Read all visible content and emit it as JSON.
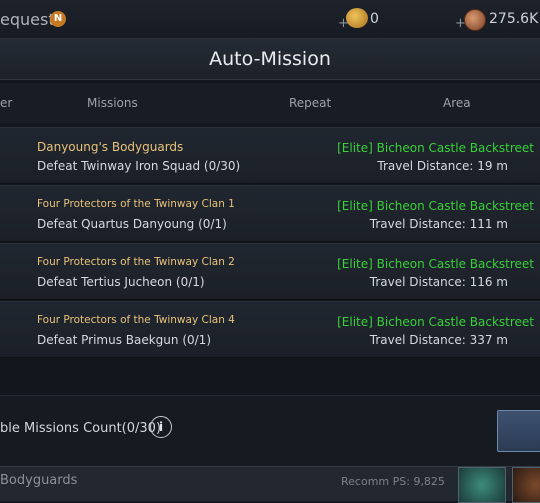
{
  "topbar": {
    "request_label": "equest",
    "badge": "N",
    "plus1": "+",
    "gold_value": "0",
    "plus2": "+",
    "copper_value": "275.6K"
  },
  "panel": {
    "title": "Auto-Mission",
    "headers": {
      "left_partial": "er",
      "missions": "Missions",
      "repeat": "Repeat",
      "area": "Area"
    }
  },
  "missions": [
    {
      "title": "Danyoung's Bodyguards",
      "objective": "Defeat Twinway Iron Squad (0/30)",
      "area": "[Elite] Bicheon Castle Backstreet",
      "distance": "Travel Distance: 19 m"
    },
    {
      "title": "Four Protectors of the Twinway Clan 1",
      "objective": "Defeat Quartus Danyoung (0/1)",
      "area": "[Elite] Bicheon Castle Backstreet",
      "distance": "Travel Distance: 111 m"
    },
    {
      "title": "Four Protectors of the Twinway Clan 2",
      "objective": "Defeat Tertius Jucheon (0/1)",
      "area": "[Elite] Bicheon Castle Backstreet",
      "distance": "Travel Distance: 116 m"
    },
    {
      "title": "Four Protectors of the Twinway Clan 4",
      "objective": "Defeat Primus Baekgun (0/1)",
      "area": "[Elite] Bicheon Castle Backstreet",
      "distance": "Travel Distance: 337 m"
    }
  ],
  "footer": {
    "count_label": "ble Missions Count(0/30)",
    "info_icon": "i"
  },
  "bottom": {
    "title": "Bodyguards",
    "recomm": "Recomm PS: 9,825"
  },
  "colors": {
    "quest_title": "#e8c27a",
    "area_green": "#37d237"
  }
}
